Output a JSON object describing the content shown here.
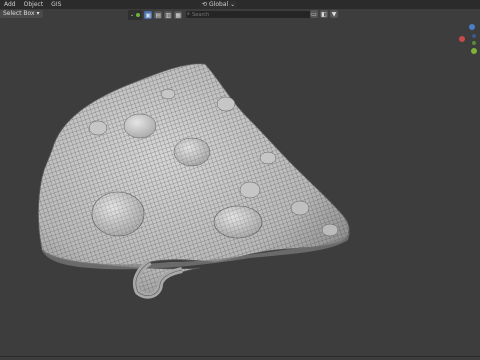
{
  "menubar": {
    "items": [
      {
        "label": "Add"
      },
      {
        "label": "Object"
      },
      {
        "label": "GIS"
      }
    ]
  },
  "select_mode": {
    "label": "Select Box ▾"
  },
  "toolbar": {
    "orientation_label": "Global",
    "search_placeholder": "Search"
  },
  "colors": {
    "background": "#3d3d3d",
    "accent": "#4a72b0",
    "gizmo_x": "#c94a4a",
    "gizmo_y": "#7db33a",
    "gizmo_z": "#4a7ec9"
  }
}
